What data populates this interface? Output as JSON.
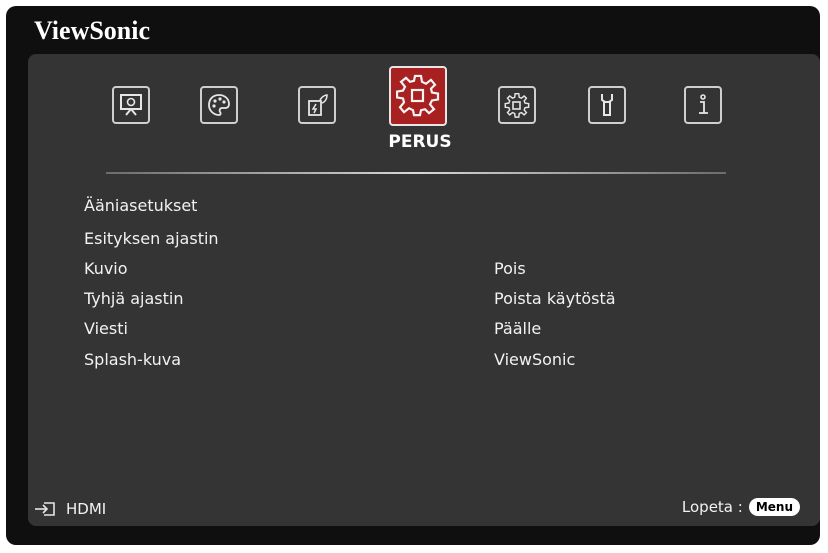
{
  "brand": "ViewSonic",
  "tabs": [
    {
      "icon": "display-icon"
    },
    {
      "icon": "color-palette-icon"
    },
    {
      "icon": "energy-saving-icon"
    },
    {
      "icon": "gear-icon",
      "label": "PERUS",
      "active": true
    },
    {
      "icon": "advanced-settings-icon"
    },
    {
      "icon": "wrench-icon"
    },
    {
      "icon": "info-icon"
    }
  ],
  "menu": [
    {
      "label": "Ääniasetukset",
      "value": ""
    },
    {
      "label": "Esityksen ajastin",
      "value": ""
    },
    {
      "label": "Kuvio",
      "value": "Pois"
    },
    {
      "label": "Tyhjä ajastin",
      "value": "Poista käytöstä"
    },
    {
      "label": "Viesti",
      "value": "Päälle"
    },
    {
      "label": "Splash-kuva",
      "value": "ViewSonic"
    }
  ],
  "footer": {
    "source_label": "HDMI",
    "exit_label": "Lopeta :",
    "menu_button": "Menu"
  },
  "colors": {
    "active_tab": "#a82020",
    "panel": "#343434",
    "frame": "#0f0f0f"
  }
}
